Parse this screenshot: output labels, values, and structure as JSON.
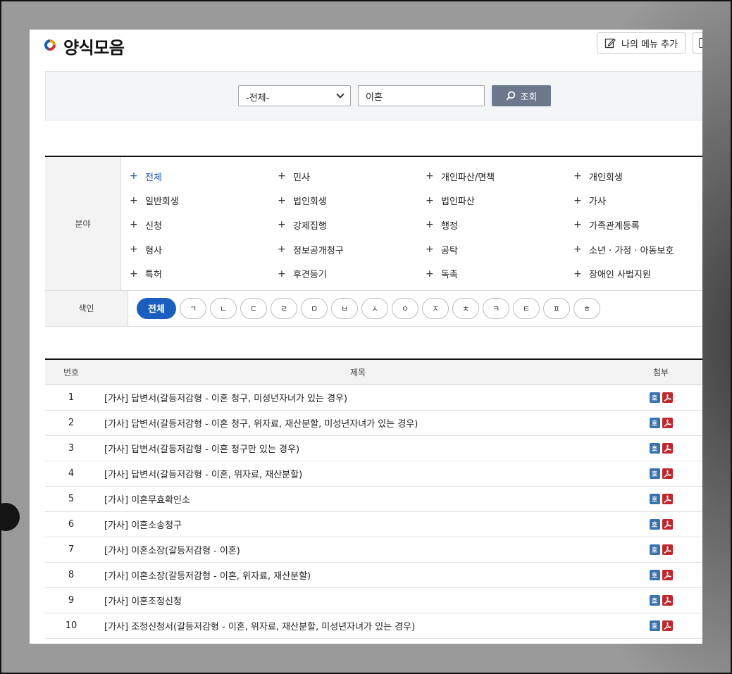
{
  "header": {
    "title": "양식모음",
    "menu_add_label": "나의 메뉴 추가"
  },
  "search": {
    "select_value": "-전체-",
    "query": "이혼",
    "button_label": "조회"
  },
  "filter": {
    "field_label": "분야",
    "fields": [
      "전체",
      "민사",
      "개인파산/면책",
      "개인회생",
      "일반회생",
      "법인회생",
      "법인파산",
      "가사",
      "신청",
      "강제집행",
      "행정",
      "가족관계등록",
      "형사",
      "정보공개청구",
      "공탁",
      "소년 · 가정 · 아동보호",
      "특허",
      "후견등기",
      "독촉",
      "장애인 사법지원"
    ],
    "active_field": "전체",
    "index_label": "색인",
    "index_items": [
      "전체",
      "ㄱ",
      "ㄴ",
      "ㄷ",
      "ㄹ",
      "ㅁ",
      "ㅂ",
      "ㅅ",
      "ㅇ",
      "ㅈ",
      "ㅊ",
      "ㅋ",
      "ㅌ",
      "ㅍ",
      "ㅎ"
    ]
  },
  "list": {
    "columns": [
      "번호",
      "제목",
      "첨부"
    ],
    "rows": [
      {
        "num": "1",
        "title": "[가사] 답변서(갈등저감형 - 이혼 청구, 미성년자녀가 있는 경우)"
      },
      {
        "num": "2",
        "title": "[가사] 답변서(갈등저감형 - 이혼 청구, 위자료, 재산분할, 미성년자녀가 있는 경우)"
      },
      {
        "num": "3",
        "title": "[가사] 답변서(갈등저감형 - 이혼 청구만 있는 경우)"
      },
      {
        "num": "4",
        "title": "[가사] 답변서(갈등저감형 - 이혼, 위자료, 재산분할)"
      },
      {
        "num": "5",
        "title": "[가사] 이혼무효확인소"
      },
      {
        "num": "6",
        "title": "[가사] 이혼소송청구"
      },
      {
        "num": "7",
        "title": "[가사] 이혼소장(갈등저감형 - 이혼)"
      },
      {
        "num": "8",
        "title": "[가사] 이혼소장(갈등저감형 - 이혼, 위자료, 재산분할)"
      },
      {
        "num": "9",
        "title": "[가사] 이혼조정신청"
      },
      {
        "num": "10",
        "title": "[가사] 조정신청서(갈등저감형 - 이혼, 위자료, 재산분할, 미성년자녀가 있는 경우)"
      }
    ],
    "hwp_glyph": "호",
    "attachment_icons": [
      "hwp-file-icon",
      "pdf-file-icon"
    ]
  },
  "colors": {
    "accent": "#1a5fbf",
    "search_button": "#6e788d",
    "hwp": "#3a72ad",
    "pdf": "#c0262d"
  }
}
